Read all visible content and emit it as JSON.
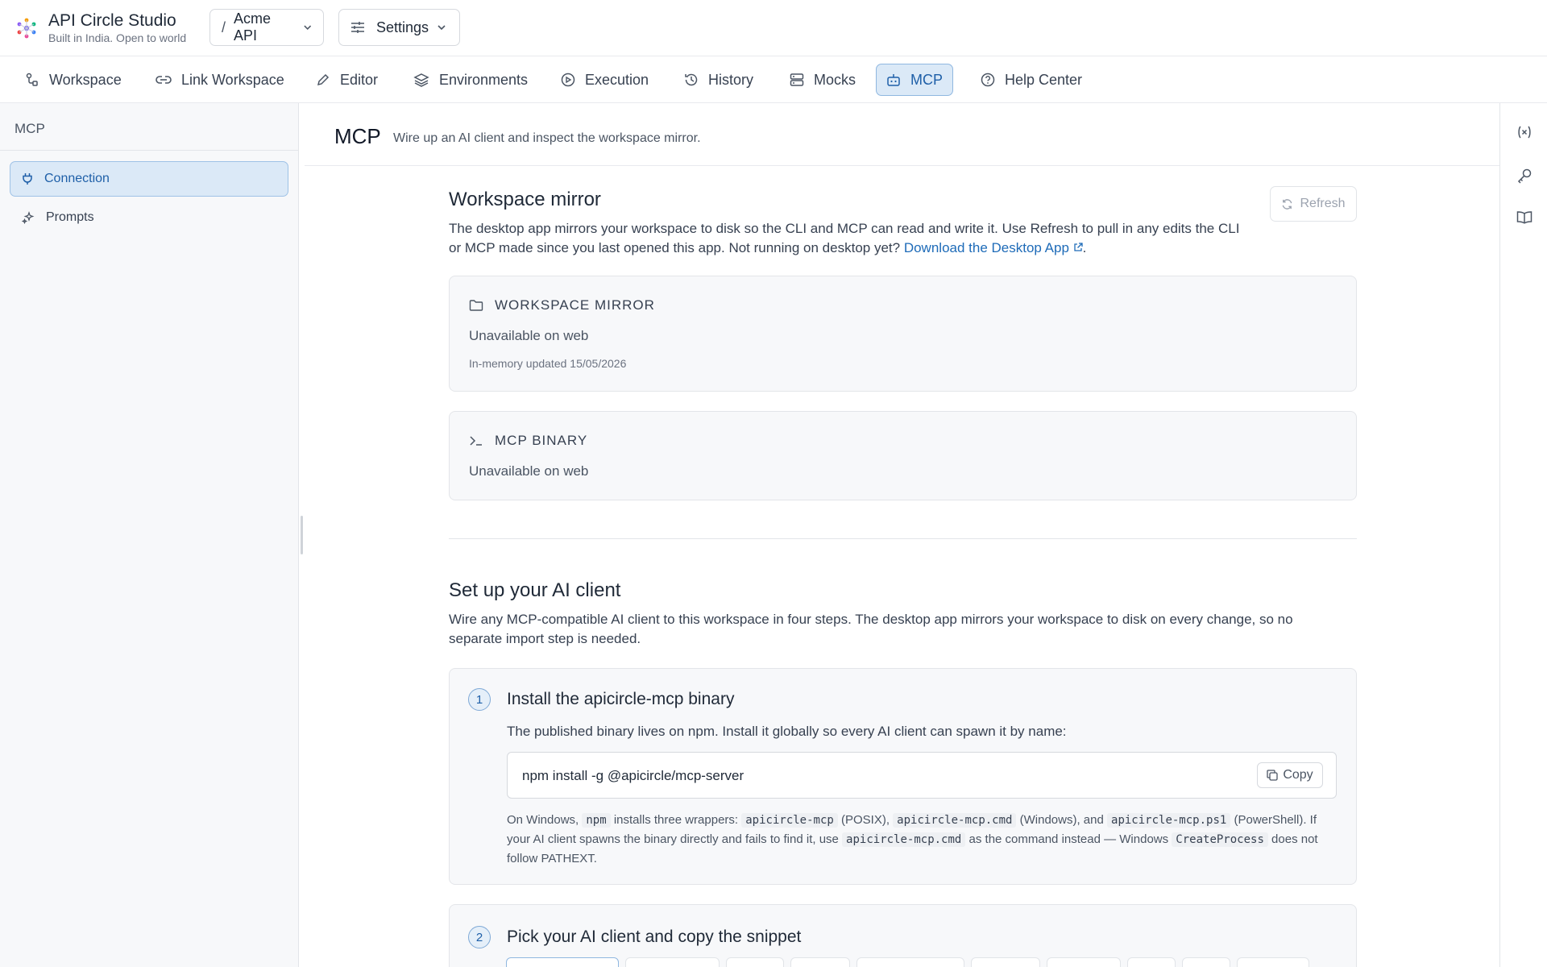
{
  "app": {
    "title": "API Circle Studio",
    "subtitle": "Built in India. Open to world",
    "workspace_slash": "/",
    "workspace_name": "Acme API",
    "settings_label": "Settings"
  },
  "nav": {
    "items": [
      {
        "label": "Workspace",
        "icon": "workspace-icon"
      },
      {
        "label": "Link Workspace",
        "icon": "link-icon"
      },
      {
        "label": "Editor",
        "icon": "pencil-icon"
      },
      {
        "label": "Environments",
        "icon": "layers-icon"
      },
      {
        "label": "Execution",
        "icon": "play-circle-icon"
      },
      {
        "label": "History",
        "icon": "history-icon"
      },
      {
        "label": "Mocks",
        "icon": "server-icon"
      },
      {
        "label": "MCP",
        "icon": "bot-icon",
        "active": true
      },
      {
        "label": "Help Center",
        "icon": "help-icon"
      }
    ]
  },
  "sidebar": {
    "title": "MCP",
    "items": [
      {
        "label": "Connection",
        "icon": "plug-icon",
        "active": true
      },
      {
        "label": "Prompts",
        "icon": "sparkles-icon"
      }
    ]
  },
  "page": {
    "title": "MCP",
    "description": "Wire up an AI client and inspect the workspace mirror."
  },
  "mirror": {
    "title": "Workspace mirror",
    "desc_line1": "The desktop app mirrors your workspace to disk so the CLI and MCP can read and write it. Use Refresh to pull in any edits the CLI",
    "desc_line2": "or MCP made since you last opened this app. Not running on desktop yet?",
    "download_link": "Download the Desktop App",
    "desc_end": ".",
    "refresh_label": "Refresh",
    "card1": {
      "heading": "WORKSPACE MIRROR",
      "status": "Unavailable on web",
      "updated": "In-memory updated 15/05/2026"
    },
    "card2": {
      "heading": "MCP BINARY",
      "status": "Unavailable on web"
    }
  },
  "setup": {
    "title": "Set up your AI client",
    "desc_line1": "Wire any MCP-compatible AI client to this workspace in four steps. The desktop app mirrors your workspace to disk on every change, so no",
    "desc_line2": "separate import step is needed.",
    "step1": {
      "number": "1",
      "title": "Install the apicircle-mcp binary",
      "text": "The published binary lives on npm. Install it globally so every AI client can spawn it by name:",
      "command": "npm install -g @apicircle/mcp-server",
      "copy_label": "Copy",
      "note_parts": [
        "On Windows, ",
        "npm",
        " installs three wrappers: ",
        "apicircle-mcp",
        " (POSIX), ",
        "apicircle-mcp.cmd",
        " (Windows), and ",
        "apicircle-mcp.ps1",
        " (PowerShell). If your AI client spawns the binary directly and fails to find it, use ",
        "apicircle-mcp.cmd",
        " as the command instead — Windows ",
        "CreateProcess",
        " does not follow PATHEXT."
      ]
    },
    "step2": {
      "number": "2",
      "title": "Pick your AI client and copy the snippet"
    }
  },
  "colors": {
    "accent": "#1e5fa8",
    "active_bg": "#dbe9f7",
    "link": "#1e6bb8"
  }
}
